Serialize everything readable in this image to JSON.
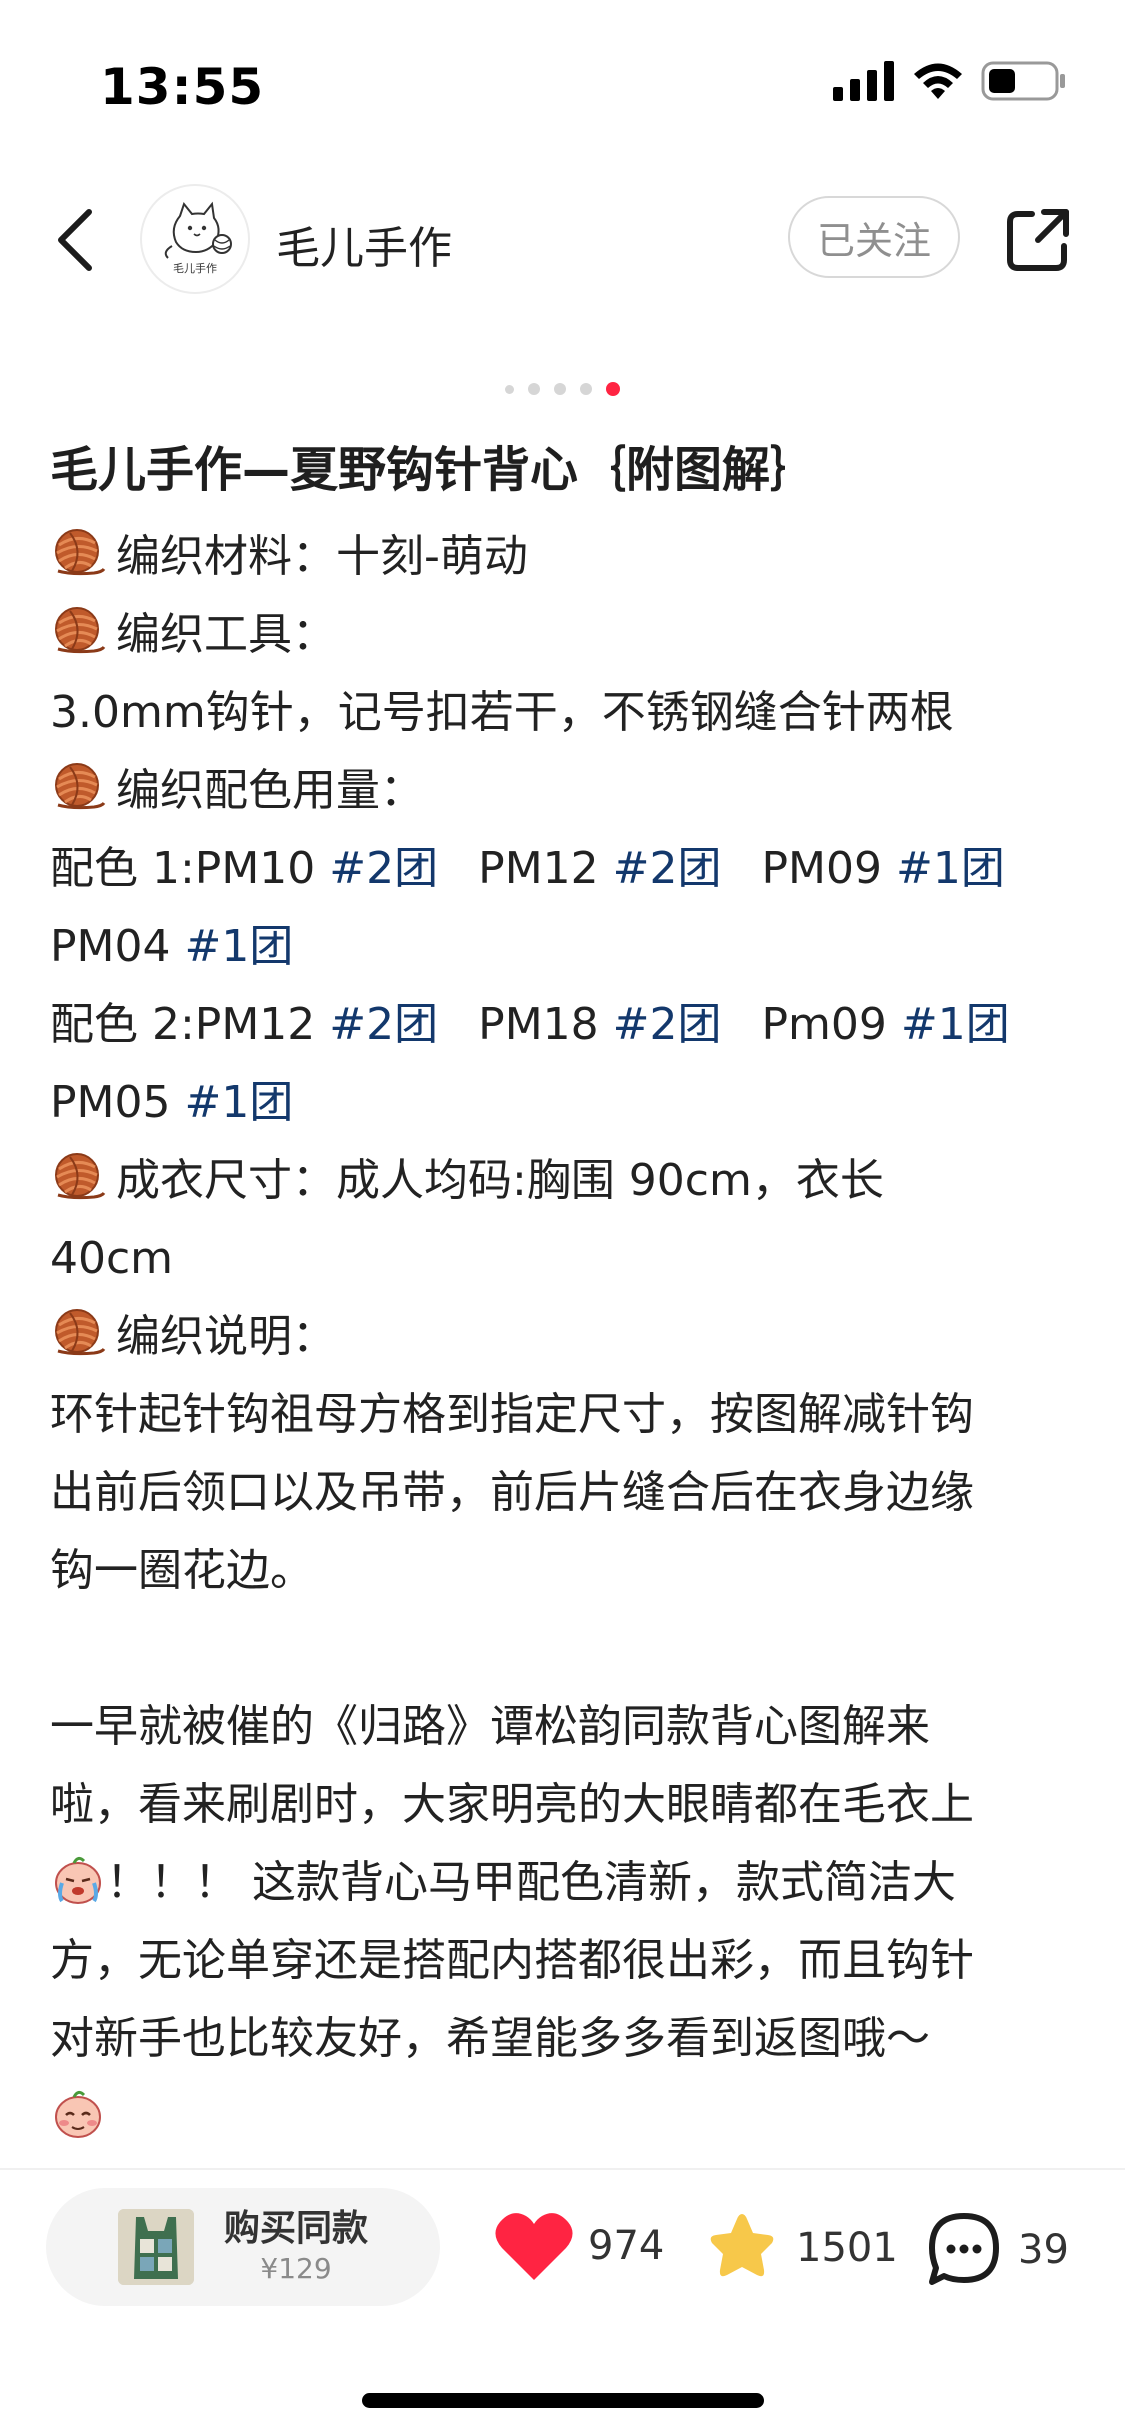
{
  "status_bar": {
    "time": "13:55"
  },
  "header": {
    "author_name": "毛儿手作",
    "follow_label": "已关注",
    "avatar_text": "毛儿手作"
  },
  "carousel": {
    "count": 5,
    "active_index": 4
  },
  "post": {
    "title": "毛儿手作—夏野钩针背心｛附图解｝",
    "lines": {
      "material": "编织材料：十刻-萌动",
      "tools_label": "编织工具：",
      "tools": "3.0mm钩针，记号扣若干，不锈钢缝合针两根",
      "colors_label": "编织配色用量：",
      "scheme1_prefix": "配色 1:PM10 ",
      "scheme1_a_tag": "#2团",
      "scheme1_b_text": "PM12 ",
      "scheme1_b_tag": "#2团",
      "scheme1_c_text": "PM09 ",
      "scheme1_c_tag": "#1团",
      "scheme1_d_text": "PM04 ",
      "scheme1_d_tag": "#1团",
      "scheme2_prefix": "配色 2:PM12 ",
      "scheme2_a_tag": "#2团",
      "scheme2_b_text": "PM18 ",
      "scheme2_b_tag": "#2团",
      "scheme2_c_text": "Pm09 ",
      "scheme2_c_tag": "#1团",
      "scheme2_d_text": "PM05 ",
      "scheme2_d_tag": "#1团",
      "size_1": "成衣尺寸：成人均码:胸围 90cm，衣长",
      "size_2": "40cm",
      "instructions_label": "编织说明：",
      "instr_1": "环针起针钩祖母方格到指定尺寸，按图解减针钩",
      "instr_2": "出前后领口以及吊带，前后片缝合后在衣身边缘",
      "instr_3": "钩一圈花边。",
      "para_1": "一早就被催的《归路》谭松韵同款背心图解来",
      "para_2": "啦，看来刷剧时，大家明亮的大眼睛都在毛衣上",
      "para_3": "！！！ 这款背心马甲配色清新，款式简洁大",
      "para_4": "方，无论单穿还是搭配内搭都很出彩，而且钩针",
      "para_5": "对新手也比较友好，希望能多多看到返图哦～"
    }
  },
  "bottom_bar": {
    "buy_label": "购买同款",
    "buy_price": "¥129",
    "likes": "974",
    "favorites": "1501",
    "comments": "39"
  },
  "colors": {
    "accent_red": "#ff2442",
    "tag_blue": "#13386c",
    "star_yellow": "#f7c84a",
    "yarn_brown": "#b5542a"
  },
  "icons": [
    "back-icon",
    "share-icon",
    "heart-icon",
    "star-icon",
    "comment-icon",
    "yarn-ball-icon",
    "crying-face-icon",
    "shy-face-icon"
  ]
}
